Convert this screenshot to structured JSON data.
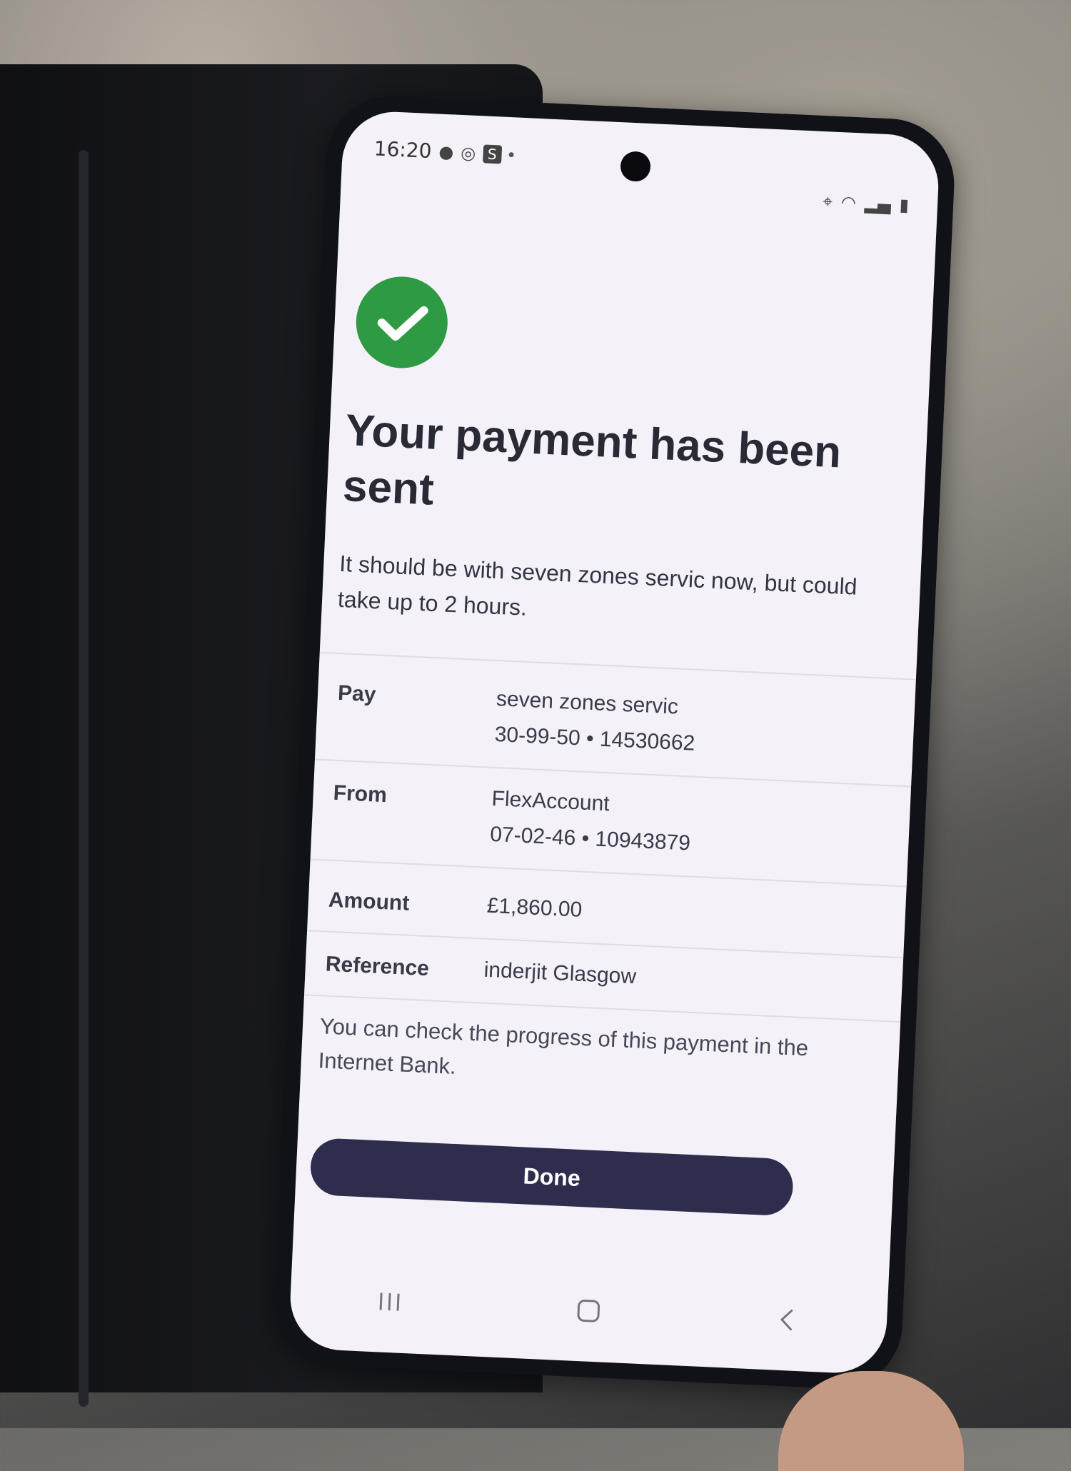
{
  "status_bar": {
    "time": "16:20",
    "left_icons": [
      "message-icon",
      "whatsapp-icon",
      "s-app-icon",
      "dot-icon"
    ],
    "right_icons": [
      "location-icon",
      "wifi-icon",
      "signal-icon",
      "battery-icon"
    ]
  },
  "confirmation": {
    "icon": "check-icon",
    "title": "Your payment has been sent",
    "subtitle": "It should be with seven zones servic now, but could take up to 2 hours."
  },
  "details": {
    "pay_label": "Pay",
    "pay_name": "seven zones servic",
    "pay_account": "30-99-50 • 14530662",
    "from_label": "From",
    "from_name": "FlexAccount",
    "from_account": "07-02-46 • 10943879",
    "amount_label": "Amount",
    "amount_value": "£1,860.00",
    "reference_label": "Reference",
    "reference_value": "inderjit Glasgow"
  },
  "note": "You can check the progress of this payment in the Internet Bank.",
  "actions": {
    "done_label": "Done"
  },
  "nav": {
    "items": [
      "recents-icon",
      "home-icon",
      "back-icon"
    ]
  },
  "colors": {
    "success": "#2f9a44",
    "primary_button": "#2e2d4d",
    "text": "#2a2a36"
  }
}
